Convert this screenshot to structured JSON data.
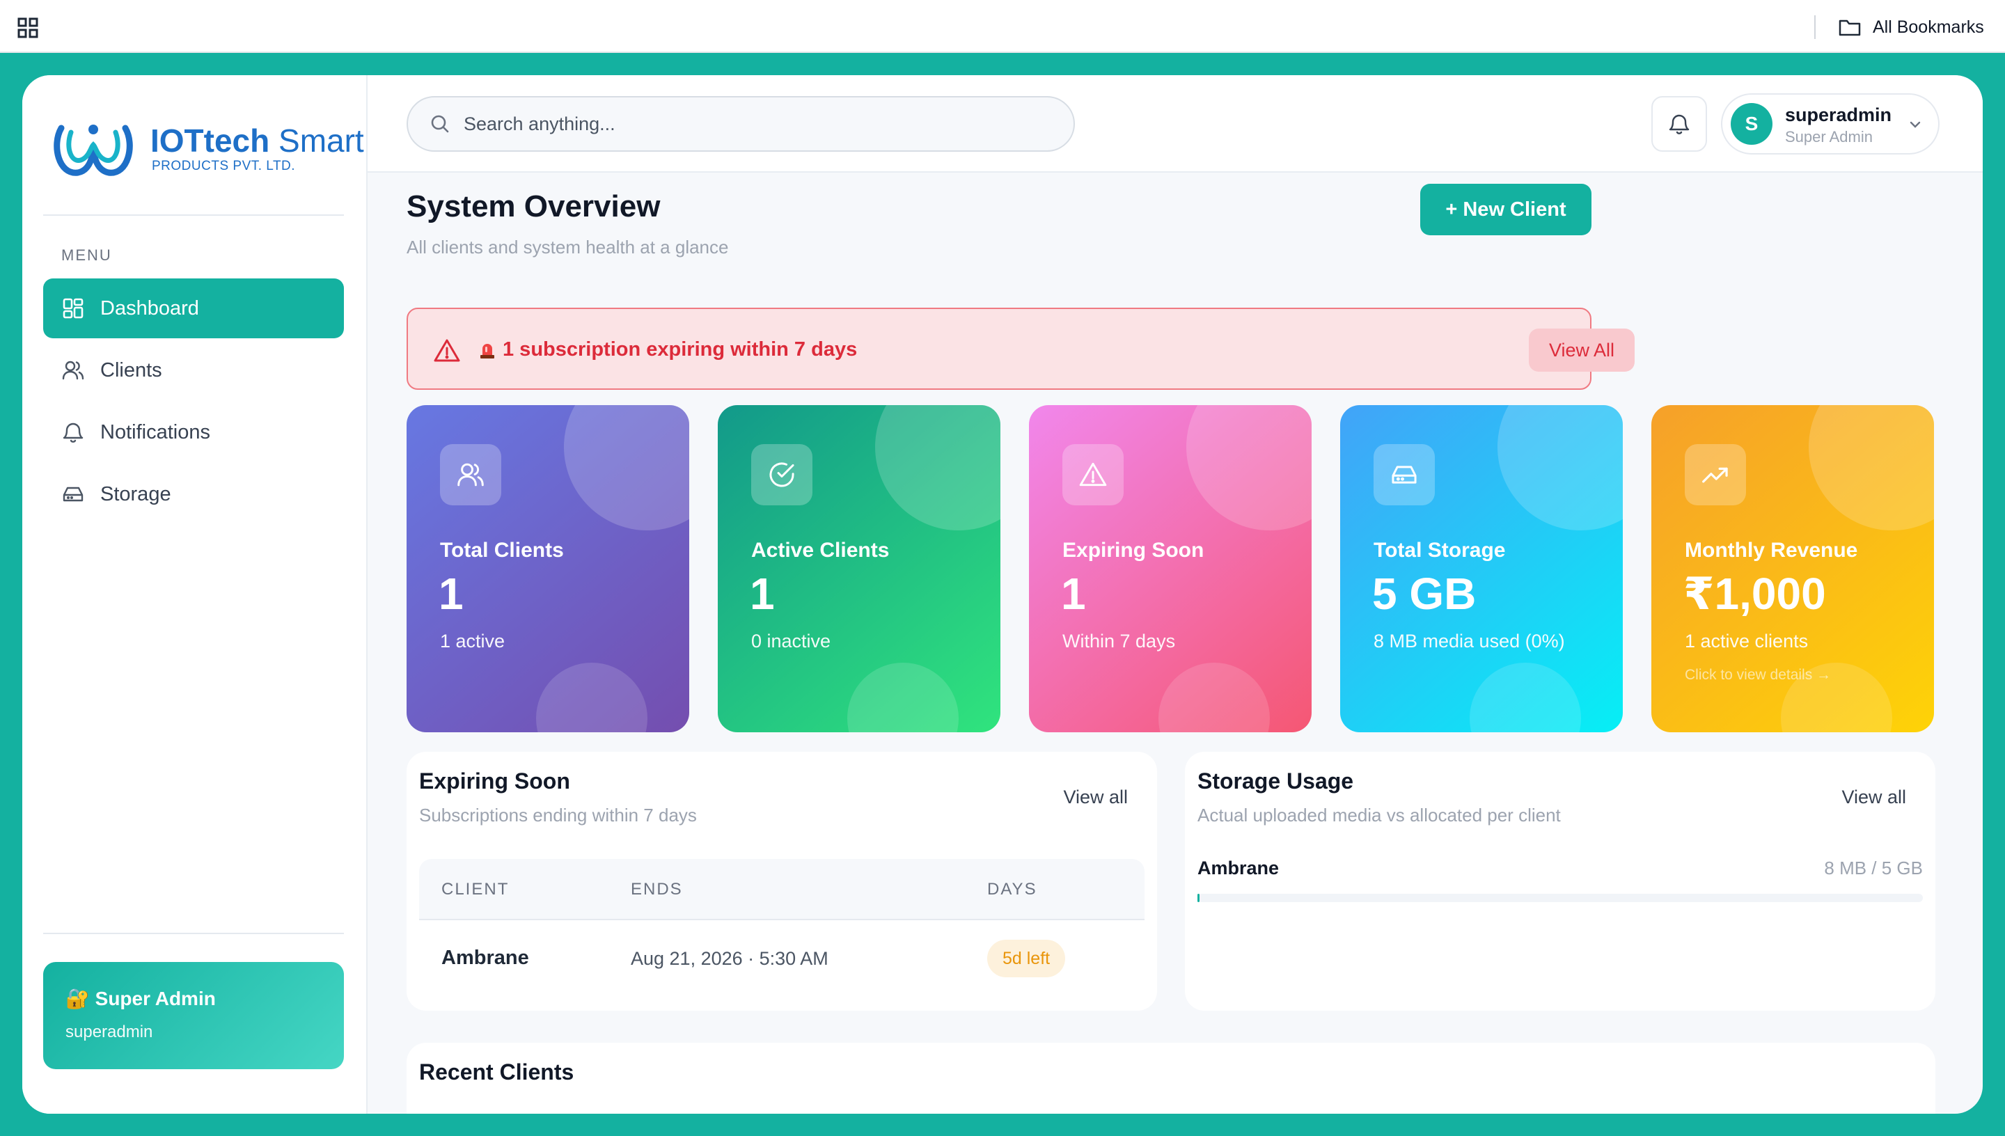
{
  "browser": {
    "bookmarks_label": "All Bookmarks"
  },
  "brand": {
    "name_bold": "IOTtech",
    "name_light": " Smart",
    "subtitle": "PRODUCTS PVT. LTD."
  },
  "sidebar": {
    "menu_label": "MENU",
    "items": [
      {
        "label": "Dashboard",
        "icon": "dashboard-icon",
        "active": true
      },
      {
        "label": "Clients",
        "icon": "users-icon",
        "active": false
      },
      {
        "label": "Notifications",
        "icon": "bell-icon",
        "active": false
      },
      {
        "label": "Storage",
        "icon": "hard-drive-icon",
        "active": false
      }
    ],
    "admin_card": {
      "title": "🔐 Super Admin",
      "username": "superadmin"
    }
  },
  "topbar": {
    "search_placeholder": "Search anything...",
    "user": {
      "initial": "S",
      "name": "superadmin",
      "role": "Super Admin"
    }
  },
  "page": {
    "title": "System Overview",
    "subtitle": "All clients and system health at a glance",
    "new_client_label": "+ New Client"
  },
  "alert": {
    "text": "1 subscription expiring within 7 days",
    "button": "View All"
  },
  "cards": [
    {
      "title": "Total Clients",
      "value": "1",
      "sub": "1 active",
      "icon": "users-icon"
    },
    {
      "title": "Active Clients",
      "value": "1",
      "sub": "0 inactive",
      "icon": "check-circle-icon"
    },
    {
      "title": "Expiring Soon",
      "value": "1",
      "sub": "Within 7 days",
      "icon": "warning-icon"
    },
    {
      "title": "Total Storage",
      "value": "5 GB",
      "sub": "8 MB media used (0%)",
      "icon": "hard-drive-icon"
    },
    {
      "title": "Monthly Revenue",
      "value": "₹1,000",
      "sub": "1 active clients",
      "link": "Click to view details →",
      "icon": "trending-up-icon"
    }
  ],
  "expiring": {
    "title": "Expiring Soon",
    "subtitle": "Subscriptions ending within 7 days",
    "link": "View all",
    "columns": [
      "CLIENT",
      "ENDS",
      "DAYS"
    ],
    "rows": [
      {
        "client": "Ambrane",
        "ends": "Aug 21, 2026 · 5:30 AM",
        "days": "5d left"
      }
    ]
  },
  "storage": {
    "title": "Storage Usage",
    "subtitle": "Actual uploaded media vs allocated per client",
    "link": "View all",
    "rows": [
      {
        "client": "Ambrane",
        "usage": "8 MB / 5 GB",
        "fraction": 0.0016
      }
    ]
  },
  "recent": {
    "title": "Recent Clients"
  },
  "colors": {
    "accent": "#14b1a0",
    "alert": "#dc2b3a",
    "warning": "#e9950a"
  }
}
